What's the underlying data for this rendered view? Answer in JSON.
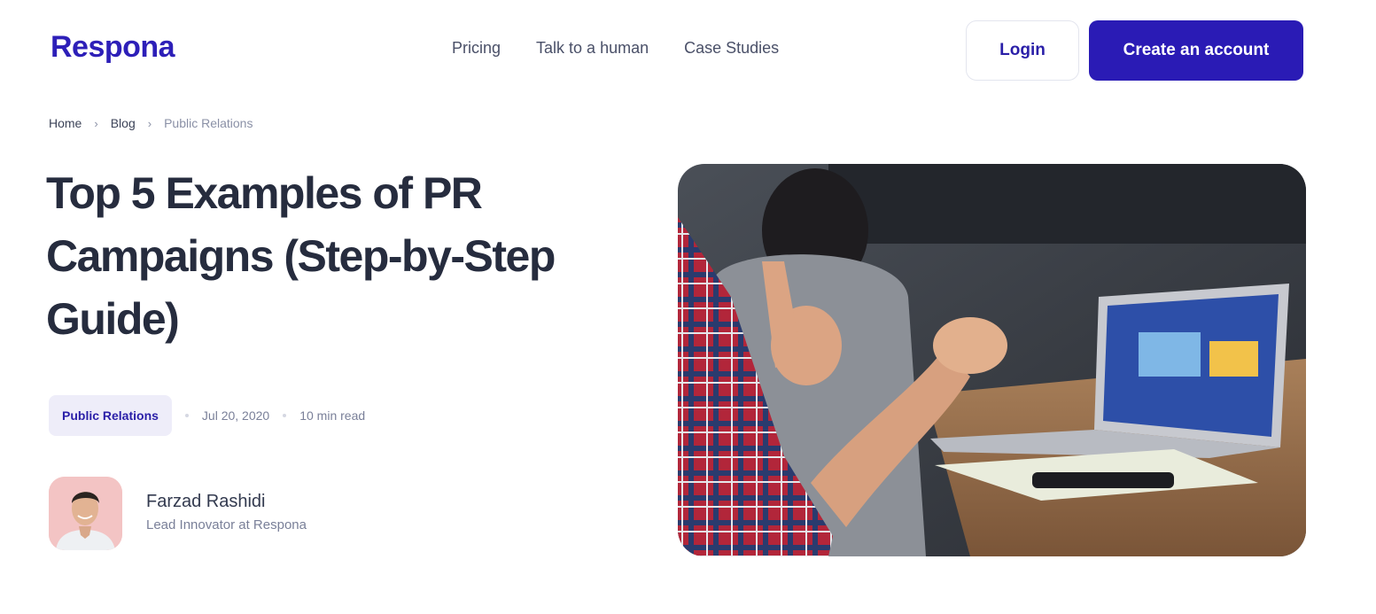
{
  "header": {
    "logo": "Respona",
    "nav": [
      "Pricing",
      "Talk to a human",
      "Case Studies"
    ],
    "login_label": "Login",
    "create_label": "Create an account"
  },
  "breadcrumb": [
    "Home",
    "Blog",
    "Public Relations"
  ],
  "article": {
    "title": "Top 5 Examples of PR Campaigns (Step-by-Step Guide)",
    "category": "Public Relations",
    "date": "Jul 20, 2020",
    "read_time": "10 min read"
  },
  "author": {
    "name": "Farzad Rashidi",
    "role": "Lead Innovator at Respona"
  },
  "colors": {
    "brand": "#2a1bb5",
    "heading": "#262c3e",
    "muted": "#7a8099",
    "tag_bg": "#eeedf9"
  }
}
